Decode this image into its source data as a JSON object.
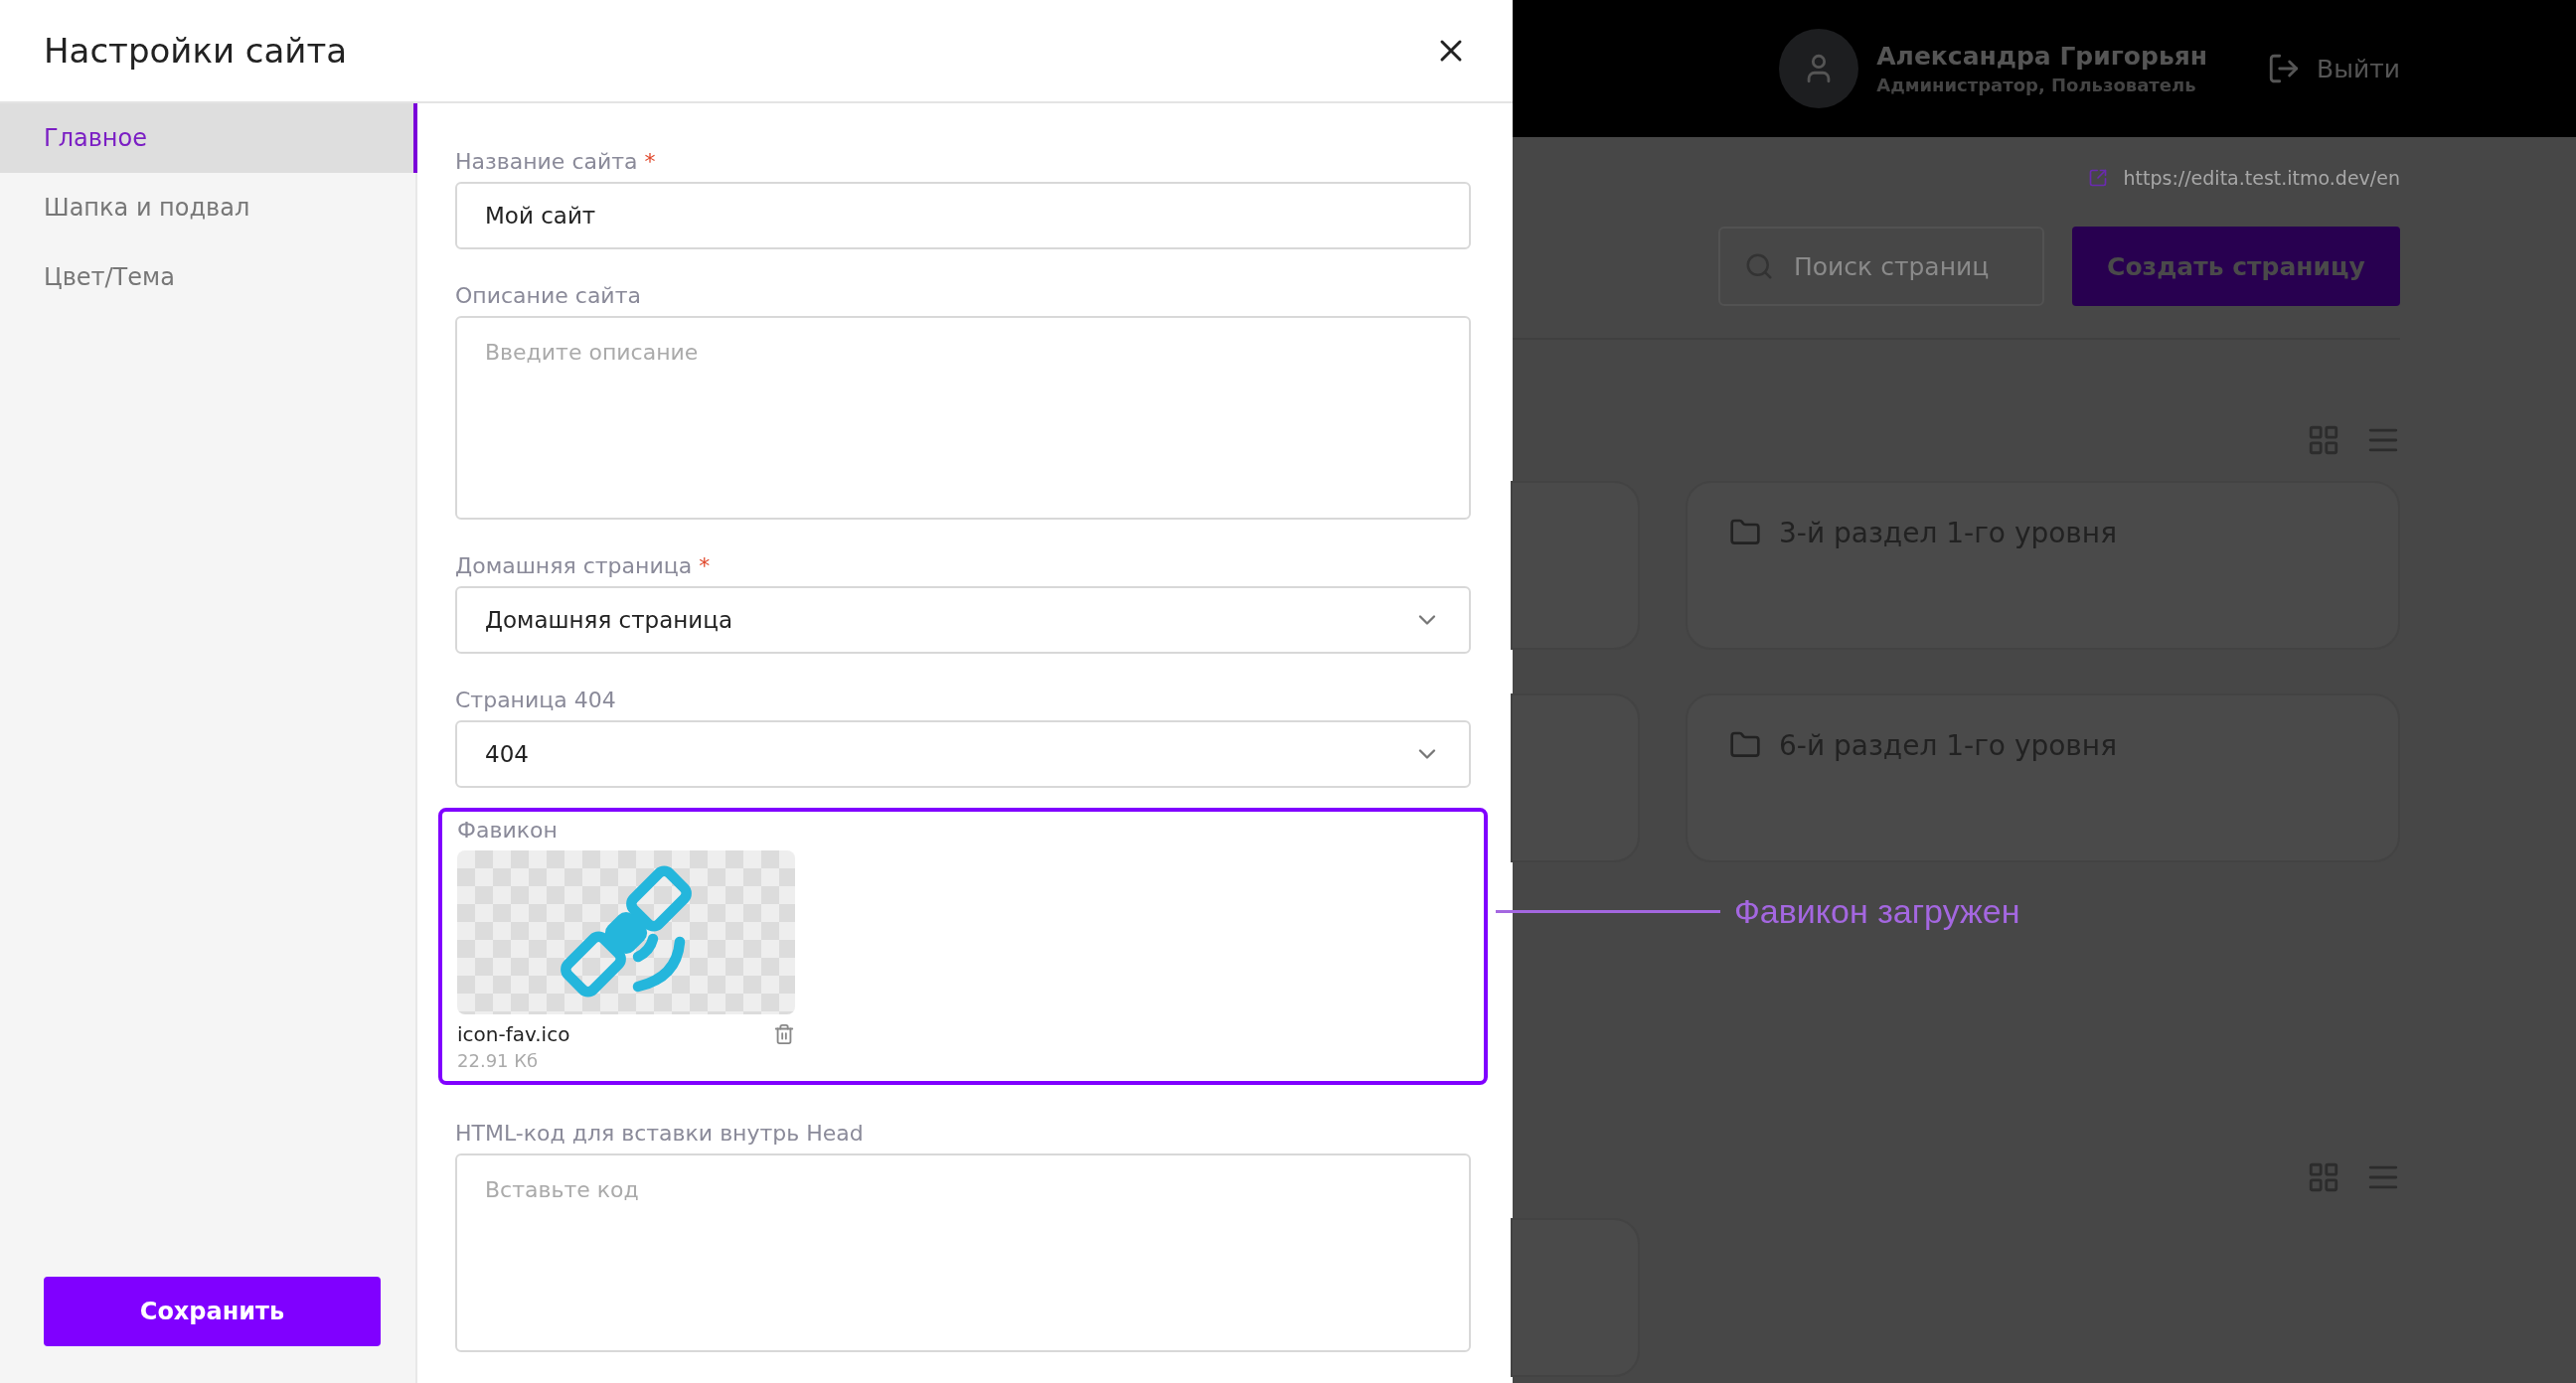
{
  "modal": {
    "title": "Настройки сайта",
    "nav": [
      {
        "label": "Главное",
        "selected": true
      },
      {
        "label": "Шапка и подвал",
        "selected": false
      },
      {
        "label": "Цвет/Тема",
        "selected": false
      }
    ],
    "save_button": "Сохранить",
    "fields": [
      {
        "kind": "text",
        "label": "Название сайта",
        "required_mark": "*",
        "value": "Мой сайт"
      },
      {
        "kind": "textarea",
        "label": "Описание сайта",
        "placeholder": "Введите описание"
      },
      {
        "kind": "select",
        "label": "Домашняя страница",
        "required_mark": "*",
        "value": "Домашняя страница"
      },
      {
        "kind": "select",
        "label": "Страница 404",
        "value": "404"
      },
      {
        "kind": "file",
        "label": "Фавикон",
        "highlighted": true,
        "file_name": "icon-fav.ico",
        "file_size": "22.91 Кб"
      },
      {
        "kind": "code",
        "label": "HTML-код для вставки внутрь Head",
        "placeholder": "Вставьте код"
      }
    ]
  },
  "annotation": {
    "text": "Фавикон загружен"
  },
  "background": {
    "user": {
      "name": "Александра Григорьян",
      "roles": "Администратор, Пользователь"
    },
    "logout": "Выйти",
    "site_url": "https://edita.test.itmo.dev/en",
    "search": {
      "placeholder": "Поиск страниц"
    },
    "create_button": "Создать страницу",
    "cards": [
      {
        "title": "3-й раздел 1-го уровня"
      },
      {
        "title": "6-й раздел 1-го уровня"
      }
    ]
  }
}
